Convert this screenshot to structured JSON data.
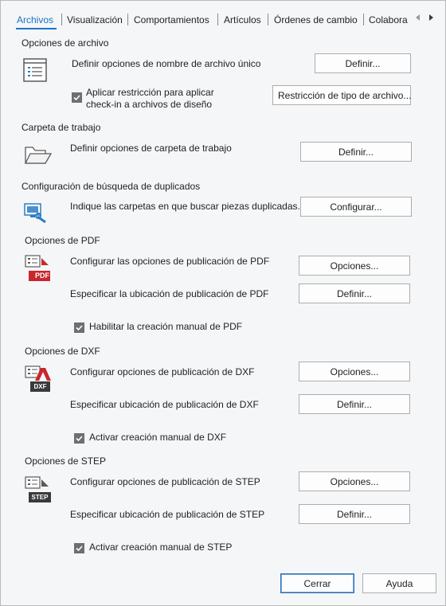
{
  "tabs": [
    {
      "label": "Archivos",
      "active": true
    },
    {
      "label": "Visualización",
      "active": false
    },
    {
      "label": "Comportamientos",
      "active": false
    },
    {
      "label": "Artículos",
      "active": false
    },
    {
      "label": "Órdenes de cambio",
      "active": false
    },
    {
      "label": "Colabora",
      "active": false
    }
  ],
  "colors": {
    "accent": "#1a73c7",
    "pdf_red": "#c8272d",
    "icon_blue": "#2b7dc4"
  },
  "file_options": {
    "title": "Opciones de archivo",
    "unique_name_label": "Definir opciones de nombre de archivo único",
    "unique_name_button": "Definir...",
    "restriction_checkbox_checked": true,
    "restriction_line1": "Aplicar restricción para aplicar",
    "restriction_line2": "check-in a archivos de diseño",
    "restriction_button": "Restricción de tipo de archivo..."
  },
  "working_folder": {
    "title": "Carpeta de trabajo",
    "label": "Definir opciones de carpeta de trabajo",
    "button": "Definir..."
  },
  "duplicates": {
    "title": "Configuración de búsqueda de duplicados",
    "label": "Indique las carpetas en que buscar piezas duplicadas.",
    "button": "Configurar..."
  },
  "pdf": {
    "title": "Opciones de PDF",
    "icon_text": "PDF",
    "publish_label": "Configurar las opciones de publicación de PDF",
    "publish_button": "Opciones...",
    "location_label": "Especificar la ubicación de publicación de PDF",
    "location_button": "Definir...",
    "manual_checked": true,
    "manual_label": "Habilitar la creación manual de PDF"
  },
  "dxf": {
    "title": "Opciones de DXF",
    "icon_text": "DXF",
    "publish_label": "Configurar opciones de publicación de DXF",
    "publish_button": "Opciones...",
    "location_label": "Especificar ubicación de publicación de DXF",
    "location_button": "Definir...",
    "manual_checked": true,
    "manual_label": "Activar creación manual de DXF"
  },
  "step": {
    "title": "Opciones de STEP",
    "icon_text": "STEP",
    "publish_label": "Configurar opciones de publicación de STEP",
    "publish_button": "Opciones...",
    "location_label": "Especificar ubicación de publicación de STEP",
    "location_button": "Definir...",
    "manual_checked": true,
    "manual_label": "Activar creación manual de STEP"
  },
  "footer": {
    "close_button": "Cerrar",
    "help_button": "Ayuda"
  }
}
